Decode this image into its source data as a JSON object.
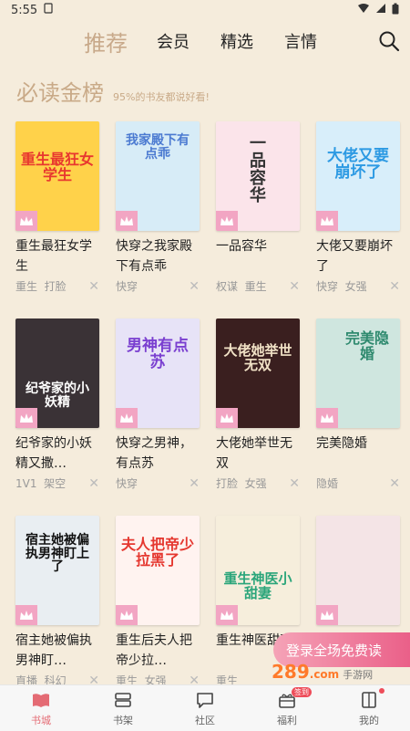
{
  "status": {
    "time": "5:55"
  },
  "nav": {
    "tabs": [
      {
        "label": "推荐",
        "active": true
      },
      {
        "label": "会员"
      },
      {
        "label": "精选"
      },
      {
        "label": "言情"
      }
    ]
  },
  "section": {
    "title": "必读金榜",
    "subtitle": "95%的书友都说好看!"
  },
  "books": [
    {
      "title": "重生最狂女学生",
      "tags": [
        "重生",
        "打脸"
      ],
      "cover_text": "重生最狂女学生",
      "cover_color": "#ffd24a"
    },
    {
      "title": "快穿之我家殿下有点乖",
      "tags": [
        "快穿"
      ],
      "cover_text": "我家殿下有点乖",
      "cover_color": "#d7ecf7"
    },
    {
      "title": "一品容华",
      "tags": [
        "权谋",
        "重生"
      ],
      "cover_text": "一品容华",
      "cover_color": "#fbe4ea"
    },
    {
      "title": "大佬又要崩坏了",
      "tags": [
        "快穿",
        "女强"
      ],
      "cover_text": "大佬又要崩坏了",
      "cover_color": "#d8eefa"
    },
    {
      "title": "纪爷家的小妖精又撒…",
      "tags": [
        "1V1",
        "架空"
      ],
      "cover_text": "纪爷家的小妖精",
      "cover_color": "#3a3236"
    },
    {
      "title": "快穿之男神，有点苏",
      "tags": [
        "快穿"
      ],
      "cover_text": "男神有点苏",
      "cover_color": "#e7e3f7"
    },
    {
      "title": "大佬她举世无双",
      "tags": [
        "打脸",
        "女强"
      ],
      "cover_text": "大佬她举世无双",
      "cover_color": "#3a1f1f"
    },
    {
      "title": "完美隐婚",
      "tags": [
        "隐婚"
      ],
      "cover_text": "完美隐婚",
      "cover_color": "#cfe6df"
    },
    {
      "title": "宿主她被偏执男神盯…",
      "tags": [
        "直播",
        "科幻"
      ],
      "cover_text": "宿主她被偏执男神盯上了",
      "cover_color": "#e9eef2"
    },
    {
      "title": "重生后夫人把帝少拉…",
      "tags": [
        "重生",
        "女强"
      ],
      "cover_text": "夫人把帝少拉黑了",
      "cover_color": "#fff3f0"
    },
    {
      "title": "重生神医甜妻",
      "tags": [
        "重生"
      ],
      "cover_text": "重生神医小甜妻",
      "cover_color": "#f6eedc"
    },
    {
      "title": "",
      "tags": [],
      "cover_text": "",
      "cover_color": "#f4e4e6"
    }
  ],
  "promo": {
    "text": "登录全场免费读"
  },
  "watermark": {
    "text": "289",
    "domain_suffix": "com",
    "cn": "手游网"
  },
  "bottom_nav": [
    {
      "label": "书城",
      "active": true
    },
    {
      "label": "书架"
    },
    {
      "label": "社区"
    },
    {
      "label": "福利",
      "badge": "签到"
    },
    {
      "label": "我的",
      "dot": true
    }
  ],
  "colors": {
    "accent": "#c9aa88",
    "active_nav": "#e46b74",
    "background": "#f5ecdc"
  }
}
